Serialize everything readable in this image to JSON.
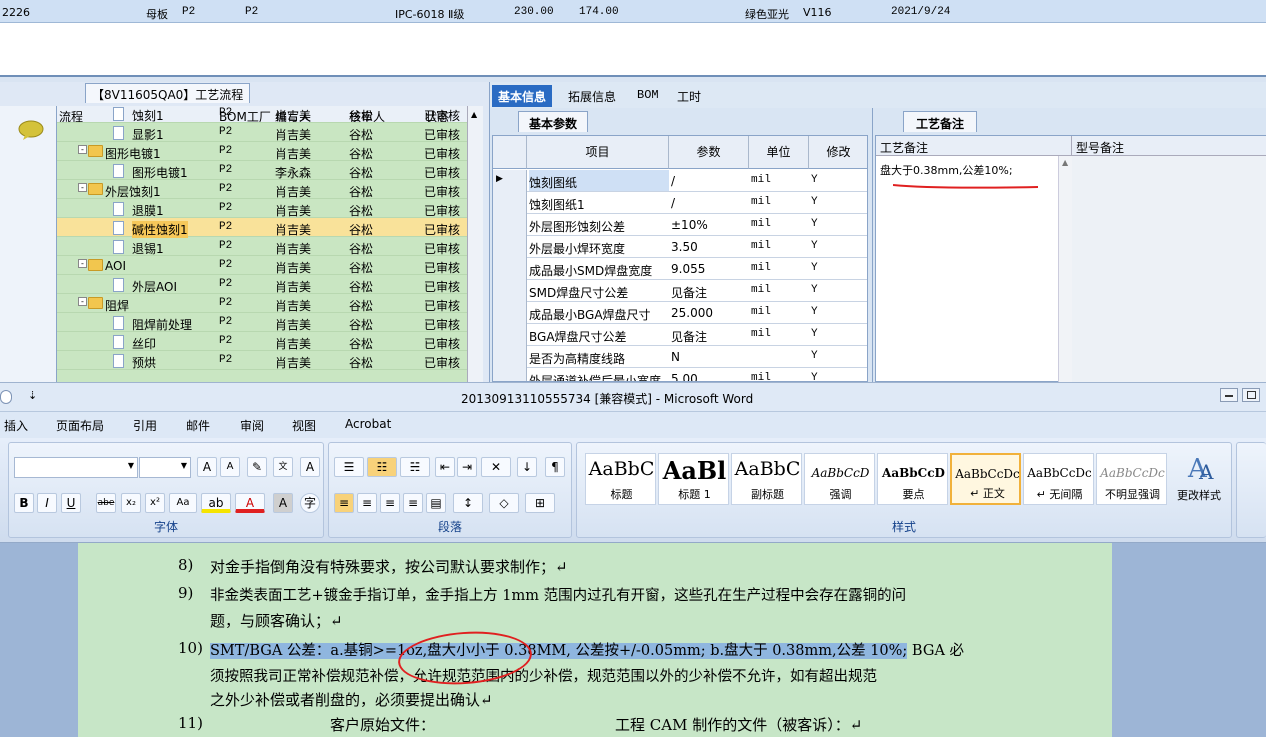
{
  "top_row": {
    "code": "2226",
    "type": "母板",
    "layer": "P2",
    "layer2": "P2",
    "grade": "IPC-6018 Ⅱ级",
    "len": "230.00",
    "wid": "174.00",
    "ink": "绿色亚光",
    "ink_code": "V116",
    "date": "2021/9/24"
  },
  "process": {
    "title": "【8V11605QA0】工艺流程",
    "headers": [
      "流程",
      "BOM工厂",
      "编写人",
      "核审人",
      "状态"
    ],
    "rows": [
      {
        "name": "蚀刻1",
        "bom": "P2",
        "writer": "肖吉美",
        "checker": "谷松",
        "status": "已审核"
      },
      {
        "name": "显影1",
        "bom": "P2",
        "writer": "肖吉美",
        "checker": "谷松",
        "status": "已审核"
      },
      {
        "name": "图形电镀1",
        "bom": "P2",
        "writer": "肖吉美",
        "checker": "谷松",
        "status": "已审核"
      },
      {
        "name": "图形电镀1",
        "bom": "P2",
        "writer": "李永森",
        "checker": "谷松",
        "status": "已审核"
      },
      {
        "name": "外层蚀刻1",
        "bom": "P2",
        "writer": "肖吉美",
        "checker": "谷松",
        "status": "已审核"
      },
      {
        "name": "退膜1",
        "bom": "P2",
        "writer": "肖吉美",
        "checker": "谷松",
        "status": "已审核"
      },
      {
        "name": "碱性蚀刻1",
        "bom": "P2",
        "writer": "肖吉美",
        "checker": "谷松",
        "status": "已审核"
      },
      {
        "name": "退锡1",
        "bom": "P2",
        "writer": "肖吉美",
        "checker": "谷松",
        "status": "已审核"
      },
      {
        "name": "AOI",
        "bom": "P2",
        "writer": "肖吉美",
        "checker": "谷松",
        "status": "已审核"
      },
      {
        "name": "外层AOI",
        "bom": "P2",
        "writer": "肖吉美",
        "checker": "谷松",
        "status": "已审核"
      },
      {
        "name": "阻焊",
        "bom": "P2",
        "writer": "肖吉美",
        "checker": "谷松",
        "status": "已审核"
      },
      {
        "name": "阻焊前处理",
        "bom": "P2",
        "writer": "肖吉美",
        "checker": "谷松",
        "status": "已审核"
      },
      {
        "name": "丝印",
        "bom": "P2",
        "writer": "肖吉美",
        "checker": "谷松",
        "status": "已审核"
      },
      {
        "name": "预烘",
        "bom": "P2",
        "writer": "肖吉美",
        "checker": "谷松",
        "status": "已审核"
      }
    ]
  },
  "tabs": [
    "基本信息",
    "拓展信息",
    "BOM",
    "工时"
  ],
  "params": {
    "label": "基本参数",
    "headers": [
      "项目",
      "参数",
      "单位",
      "修改"
    ],
    "rows": [
      {
        "item": "蚀刻图纸",
        "value": "/",
        "unit": "mil",
        "edit": "Y"
      },
      {
        "item": "蚀刻图纸1",
        "value": "/",
        "unit": "mil",
        "edit": "Y"
      },
      {
        "item": "外层图形蚀刻公差",
        "value": "±10%",
        "unit": "mil",
        "edit": "Y"
      },
      {
        "item": "外层最小焊环宽度",
        "value": "3.50",
        "unit": "mil",
        "edit": "Y"
      },
      {
        "item": "成品最小SMD焊盘宽度",
        "value": "9.055",
        "unit": "mil",
        "edit": "Y"
      },
      {
        "item": "SMD焊盘尺寸公差",
        "value": "见备注",
        "unit": "mil",
        "edit": "Y"
      },
      {
        "item": "成品最小BGA焊盘尺寸",
        "value": "25.000",
        "unit": "mil",
        "edit": "Y"
      },
      {
        "item": "BGA焊盘尺寸公差",
        "value": "见备注",
        "unit": "mil",
        "edit": "Y"
      },
      {
        "item": "是否为高精度线路",
        "value": "N",
        "unit": "",
        "edit": "Y"
      },
      {
        "item": "外层通道补偿后最小宽度",
        "value": "5.00",
        "unit": "mil",
        "edit": "Y"
      }
    ]
  },
  "notes": {
    "label": "工艺备注",
    "col1": "工艺备注",
    "col2": "型号备注",
    "text": "盘大于0.38mm,公差10%;"
  },
  "word": {
    "title": "20130913110555734 [兼容模式] - Microsoft Word",
    "menus": [
      "插入",
      "页面布局",
      "引用",
      "邮件",
      "审阅",
      "视图",
      "Acrobat"
    ],
    "groups": {
      "font": "字体",
      "para": "段落",
      "styles": "样式"
    },
    "styles": [
      {
        "sample": "AaBbC",
        "name": "标题"
      },
      {
        "sample": "AaBl",
        "name": "标题 1"
      },
      {
        "sample": "AaBbC",
        "name": "副标题"
      },
      {
        "sample": "AaBbCcD",
        "name": "强调"
      },
      {
        "sample": "AaBbCcD",
        "name": "要点"
      },
      {
        "sample": "AaBbCcDc",
        "name": "↵ 正文"
      },
      {
        "sample": "AaBbCcDc",
        "name": "↵ 无间隔"
      },
      {
        "sample": "AaBbCcDc",
        "name": "不明显强调"
      }
    ],
    "change_styles": "更改样式",
    "doc": {
      "l8n": "8)",
      "l8": "对金手指倒角没有特殊要求，按公司默认要求制作；↵",
      "l9n": "9)",
      "l9a": "非金类表面工艺+镀金手指订单，金手指上方 1mm 范围内过孔有开窗，这些孔在生产过程中会存在露铜的问",
      "l9b": "题，与顾客确认；↵",
      "l10n": "10)",
      "l10hl": "SMT/BGA 公差：a.基铜>=1oz,盘大小小于 0.38MM, 公差按+/-0.05mm; b.盘大于 0.38mm,公差 10%;",
      "l10rest": " BGA 必",
      "l10b": "须按照我司正常补偿规范补偿，允许规范范围内的少补偿，规范范围以外的少补偿不允许，如有超出规范",
      "l10c": "之外少补偿或者削盘的，必须要提出确认↵",
      "l11n": "11)",
      "l11a": "客户原始文件：",
      "l11b": "工程 CAM 制作的文件（被客诉）：↵"
    }
  }
}
